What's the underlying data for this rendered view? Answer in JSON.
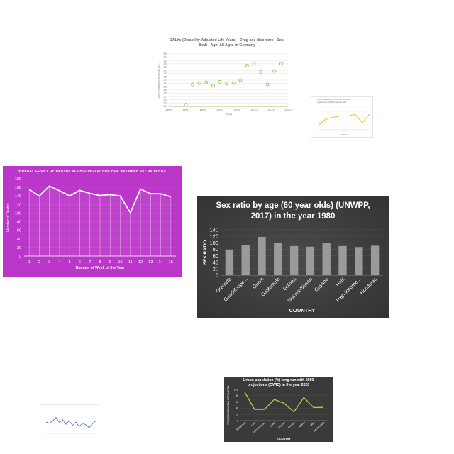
{
  "chart_data": [
    {
      "id": "dalys",
      "type": "scatter",
      "title": "DALYs (Disability-Adjusted Life Years) - Drug use disorders - Sex: Both - Age: All Ages in Germany",
      "xlabel": "YEAR",
      "ylabel": "DALYS (DISABILITY-ADJUSTED LIFE...",
      "xlim": [
        1985,
        2020
      ],
      "ylim": [
        195,
        355
      ],
      "xticks": [
        1985,
        1990,
        1995,
        2000,
        2005,
        2010,
        2015,
        2020
      ],
      "yticks": [
        195,
        205,
        215,
        225,
        235,
        245,
        255,
        265,
        275,
        285,
        295,
        305,
        315,
        325,
        335,
        345,
        355
      ],
      "x": [
        1990,
        1992,
        1994,
        1996,
        1998,
        2000,
        2002,
        2004,
        2006,
        2008,
        2010,
        2012,
        2014,
        2016,
        2018
      ],
      "y": [
        200,
        262,
        266,
        268,
        258,
        270,
        265,
        266,
        275,
        320,
        325,
        300,
        262,
        303,
        325
      ],
      "grid": true,
      "colors": {
        "marker": "#8bc34a",
        "grid": "#e0e0e0"
      }
    },
    {
      "id": "urban-small",
      "type": "line",
      "title": "Urban population (%) long-run with 2050 projections (OWID) in the year 2020",
      "xlabel": "COUNTRY",
      "ylabel": "",
      "ylim": [
        0,
        100
      ],
      "categories": [
        "",
        "",
        "",
        "",
        "",
        "",
        "",
        ""
      ],
      "values": [
        20,
        48,
        55,
        62,
        60,
        68,
        32,
        70
      ],
      "colors": {
        "line": "#f5b800"
      }
    },
    {
      "id": "ohio",
      "type": "area",
      "title": "WEEKLY COUNT OF DEATHS IN OHIO IN 2017 FOR AGE BETWEEN 25 - 45 YEARS",
      "xlabel": "Number of Week of the Year",
      "ylabel": "Number of Deaths",
      "ylim": [
        0,
        180
      ],
      "yticks": [
        0,
        20,
        40,
        60,
        80,
        100,
        120,
        140,
        160,
        180
      ],
      "categories": [
        "1",
        "2",
        "3",
        "4",
        "5",
        "6",
        "7",
        "8",
        "9",
        "10",
        "11",
        "12",
        "13",
        "14",
        "15"
      ],
      "values": [
        155,
        140,
        163,
        152,
        140,
        153,
        146,
        141,
        143,
        140,
        101,
        156,
        145,
        145,
        138
      ],
      "colors": {
        "background": "#bb37c9",
        "line": "#ffffff"
      }
    },
    {
      "id": "sex-ratio",
      "type": "bar",
      "title": "Sex ratio by age (60 year olds) (UNWPP, 2017) in the year 1980",
      "xlabel": "COUNTRY",
      "ylabel": "SEX RATIO",
      "ylim": [
        0,
        140
      ],
      "yticks": [
        0,
        20,
        40,
        60,
        80,
        100,
        120,
        140
      ],
      "categories": [
        "Grenada",
        "Guadeloupe...",
        "Guam",
        "Guatemala",
        "Guinea",
        "Guinea-Bissau",
        "Guyana",
        "Haiti",
        "High-income...",
        "Honduras"
      ],
      "values": [
        79,
        93,
        118,
        100,
        90,
        88,
        99,
        90,
        87,
        91
      ],
      "colors": {
        "background": "#3d3d3d",
        "bar": "#9a9a9a"
      }
    },
    {
      "id": "weekly-blue",
      "type": "line",
      "title": "",
      "xlabel": "",
      "ylabel": "",
      "ylim": [
        0,
        100
      ],
      "categories": [
        "",
        "",
        "",
        "",
        "",
        "",
        "",
        "",
        "",
        "",
        "",
        "",
        "",
        "",
        "",
        ""
      ],
      "values": [
        50,
        45,
        55,
        70,
        48,
        60,
        40,
        55,
        35,
        50,
        30,
        45,
        38,
        25,
        42,
        55
      ],
      "colors": {
        "line": "#3f6fc2"
      }
    },
    {
      "id": "urban-dark",
      "type": "line",
      "title": "Urban population (%) long-run with 2050 projections (OWID) in the year 2020",
      "xlabel": "COUNTRY",
      "ylabel": "PERCENTAGE URBAN POPULATION",
      "ylim": [
        0,
        100
      ],
      "yticks": [
        0,
        20,
        40,
        60,
        80,
        100
      ],
      "categories": [
        "Kyrgyzstan",
        "Laos",
        "Latin America...",
        "Latvia",
        "Lebanon",
        "Lesotho",
        "Liberia",
        "Libya",
        "Liechtenstein"
      ],
      "values": [
        92,
        36,
        36,
        68,
        56,
        28,
        74,
        42,
        43
      ],
      "colors": {
        "background": "#3a3a3a",
        "line": "#a6d64a"
      }
    }
  ]
}
